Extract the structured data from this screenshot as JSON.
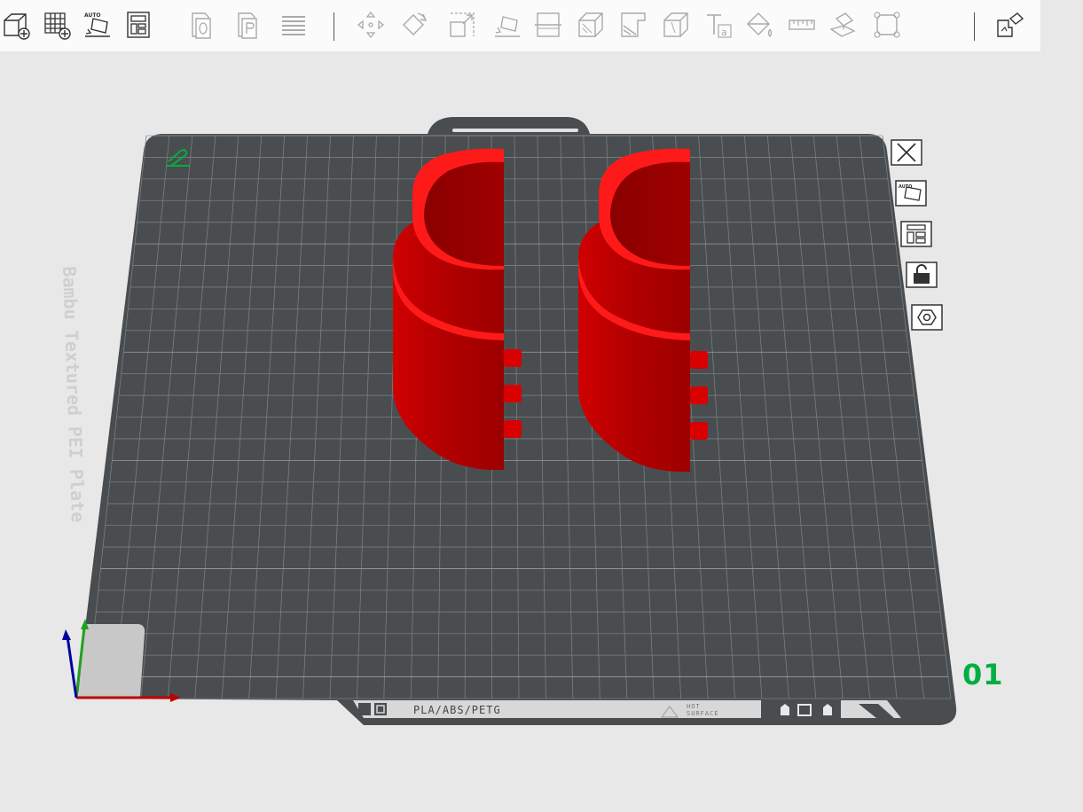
{
  "toolbar": {
    "items": [
      {
        "name": "add-object",
        "icon": "cube-plus-icon"
      },
      {
        "name": "add-plate",
        "icon": "grid-plus-icon"
      },
      {
        "name": "auto-orient",
        "icon": "auto-orient-icon",
        "badge": "AUTO"
      },
      {
        "name": "arrange",
        "icon": "arrange-icon"
      },
      {
        "name": "split-objects",
        "icon": "split-objects-icon"
      },
      {
        "name": "split-parts",
        "icon": "split-parts-icon"
      },
      {
        "name": "variable-layer",
        "icon": "layers-icon"
      },
      {
        "name": "move",
        "icon": "move-icon"
      },
      {
        "name": "rotate",
        "icon": "rotate-icon"
      },
      {
        "name": "scale",
        "icon": "scale-icon"
      },
      {
        "name": "lay-on-face",
        "icon": "lay-on-face-icon"
      },
      {
        "name": "cut",
        "icon": "cut-icon"
      },
      {
        "name": "support-paint",
        "icon": "support-paint-icon"
      },
      {
        "name": "seam-paint",
        "icon": "seam-paint-icon"
      },
      {
        "name": "boolean",
        "icon": "boolean-icon"
      },
      {
        "name": "text",
        "icon": "text-icon"
      },
      {
        "name": "color-paint",
        "icon": "paint-bucket-icon"
      },
      {
        "name": "measure",
        "icon": "ruler-icon"
      },
      {
        "name": "assembly",
        "icon": "assembly-icon"
      },
      {
        "name": "fit",
        "icon": "fit-icon"
      },
      {
        "name": "assembly-view",
        "icon": "assembly-view-icon"
      }
    ]
  },
  "plate": {
    "label": "Bambu Textured PEI Plate",
    "number": "01",
    "strip_text": "PLA/ABS/PETG",
    "hot_line1": "HOT",
    "hot_line2": "SURFACE"
  },
  "plate_tools": [
    {
      "name": "delete-plate",
      "icon": "close-icon"
    },
    {
      "name": "auto-orient-plate",
      "icon": "auto-orient-icon"
    },
    {
      "name": "arrange-plate",
      "icon": "arrange-icon"
    },
    {
      "name": "lock-plate",
      "icon": "lock-icon"
    },
    {
      "name": "plate-settings",
      "icon": "hexagon-settings-icon"
    }
  ],
  "colors": {
    "accent": "#00ae42",
    "plate": "#4a4d4f",
    "model": "#e00000",
    "background": "#e8e8e8"
  }
}
